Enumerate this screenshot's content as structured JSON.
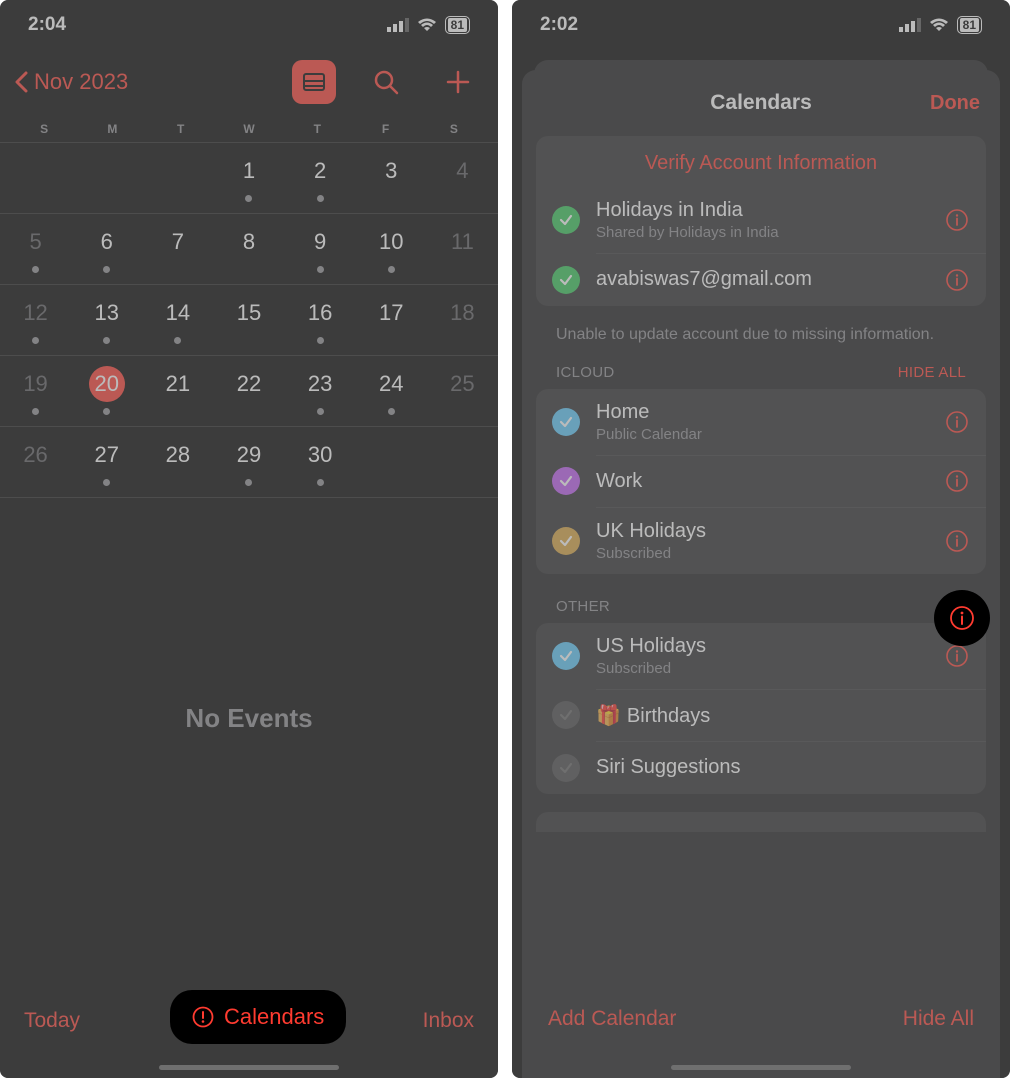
{
  "left": {
    "status": {
      "time": "2:04",
      "battery": "81"
    },
    "nav": {
      "back_label": "Nov 2023"
    },
    "weekdays": [
      "S",
      "M",
      "T",
      "W",
      "T",
      "F",
      "S"
    ],
    "weeks": [
      [
        {
          "n": "",
          "d": false
        },
        {
          "n": "",
          "d": false
        },
        {
          "n": "",
          "d": false
        },
        {
          "n": "1",
          "d": true
        },
        {
          "n": "2",
          "d": true
        },
        {
          "n": "3",
          "d": false
        },
        {
          "n": "4",
          "d": false,
          "dim": true
        }
      ],
      [
        {
          "n": "5",
          "d": true,
          "dim": true
        },
        {
          "n": "6",
          "d": true
        },
        {
          "n": "7",
          "d": false
        },
        {
          "n": "8",
          "d": false
        },
        {
          "n": "9",
          "d": true
        },
        {
          "n": "10",
          "d": true
        },
        {
          "n": "11",
          "d": false,
          "dim": true
        }
      ],
      [
        {
          "n": "12",
          "d": true,
          "dim": true
        },
        {
          "n": "13",
          "d": true
        },
        {
          "n": "14",
          "d": true
        },
        {
          "n": "15",
          "d": false
        },
        {
          "n": "16",
          "d": true
        },
        {
          "n": "17",
          "d": false
        },
        {
          "n": "18",
          "d": false,
          "dim": true
        }
      ],
      [
        {
          "n": "19",
          "d": true,
          "dim": true
        },
        {
          "n": "20",
          "d": true,
          "today": true
        },
        {
          "n": "21",
          "d": false
        },
        {
          "n": "22",
          "d": false
        },
        {
          "n": "23",
          "d": true
        },
        {
          "n": "24",
          "d": true
        },
        {
          "n": "25",
          "d": false,
          "dim": true
        }
      ],
      [
        {
          "n": "26",
          "d": false,
          "dim": true
        },
        {
          "n": "27",
          "d": true
        },
        {
          "n": "28",
          "d": false
        },
        {
          "n": "29",
          "d": true
        },
        {
          "n": "30",
          "d": true
        },
        {
          "n": "",
          "d": false
        },
        {
          "n": "",
          "d": false
        }
      ]
    ],
    "no_events": "No Events",
    "toolbar": {
      "today": "Today",
      "calendars": "Calendars",
      "inbox": "Inbox"
    }
  },
  "right": {
    "status": {
      "time": "2:02",
      "battery": "81"
    },
    "sheet": {
      "title": "Calendars",
      "done": "Done",
      "verify_header": "Verify Account Information",
      "verify_items": [
        {
          "title": "Holidays in India",
          "sub": "Shared by Holidays in India",
          "color": "#34c759"
        },
        {
          "title": "avabiswas7@gmail.com",
          "sub": "",
          "color": "#34c759"
        }
      ],
      "verify_note": "Unable to update account due to missing information.",
      "icloud_label": "ICLOUD",
      "hide_all_label": "HIDE ALL",
      "icloud_items": [
        {
          "title": "Home",
          "sub": "Public Calendar",
          "color": "#5ac8fa"
        },
        {
          "title": "Work",
          "sub": "",
          "color": "#bf5af2"
        },
        {
          "title": "UK Holidays",
          "sub": "Subscribed",
          "color": "#d9a441"
        }
      ],
      "other_label": "OTHER",
      "other_items": [
        {
          "title": "US Holidays",
          "sub": "Subscribed",
          "color": "#5ac8fa",
          "checked": true
        },
        {
          "title": "Birthdays",
          "sub": "",
          "color": "#8e8e93",
          "checked": false,
          "gift": true
        },
        {
          "title": "Siri Suggestions",
          "sub": "",
          "color": "#8e8e93",
          "checked": false
        }
      ],
      "toolbar": {
        "add": "Add Calendar",
        "hide": "Hide All"
      }
    }
  },
  "colors": {
    "accent": "#ff3b30"
  }
}
